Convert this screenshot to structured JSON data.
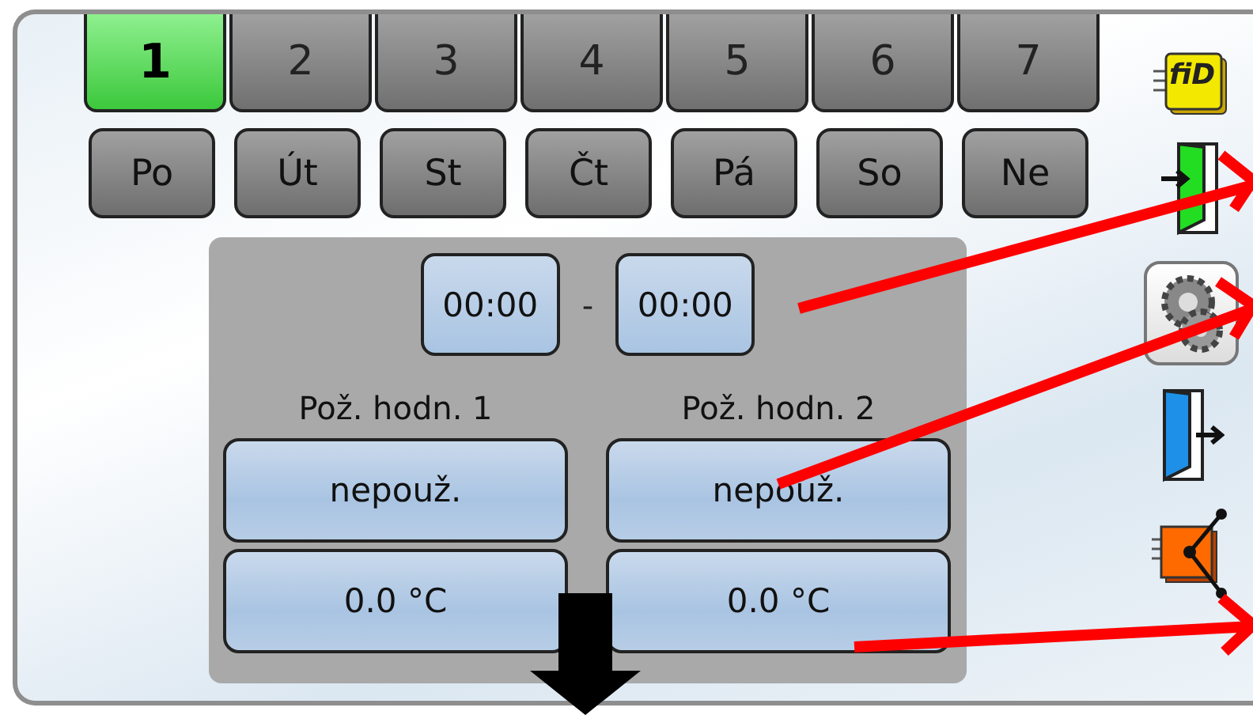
{
  "program_tabs": [
    {
      "label": "1",
      "selected": true
    },
    {
      "label": "2",
      "selected": false
    },
    {
      "label": "3",
      "selected": false
    },
    {
      "label": "4",
      "selected": false
    },
    {
      "label": "5",
      "selected": false
    },
    {
      "label": "6",
      "selected": false
    },
    {
      "label": "7",
      "selected": false
    }
  ],
  "days": [
    {
      "label": "Po"
    },
    {
      "label": "Út"
    },
    {
      "label": "St"
    },
    {
      "label": "Čt"
    },
    {
      "label": "Pá"
    },
    {
      "label": "So"
    },
    {
      "label": "Ne"
    }
  ],
  "time_window": {
    "start": "00:00",
    "separator": "-",
    "end": "00:00"
  },
  "setpoints": [
    {
      "label": "Pož. hodn. 1",
      "mode": "nepouž.",
      "value": "0.0 °C"
    },
    {
      "label": "Pož. hodn. 2",
      "mode": "nepouž.",
      "value": "0.0 °C"
    }
  ],
  "side_icons": [
    {
      "kind": "fid",
      "text": "fiD"
    },
    {
      "kind": "enter"
    },
    {
      "kind": "settings"
    },
    {
      "kind": "exit"
    },
    {
      "kind": "network"
    }
  ]
}
